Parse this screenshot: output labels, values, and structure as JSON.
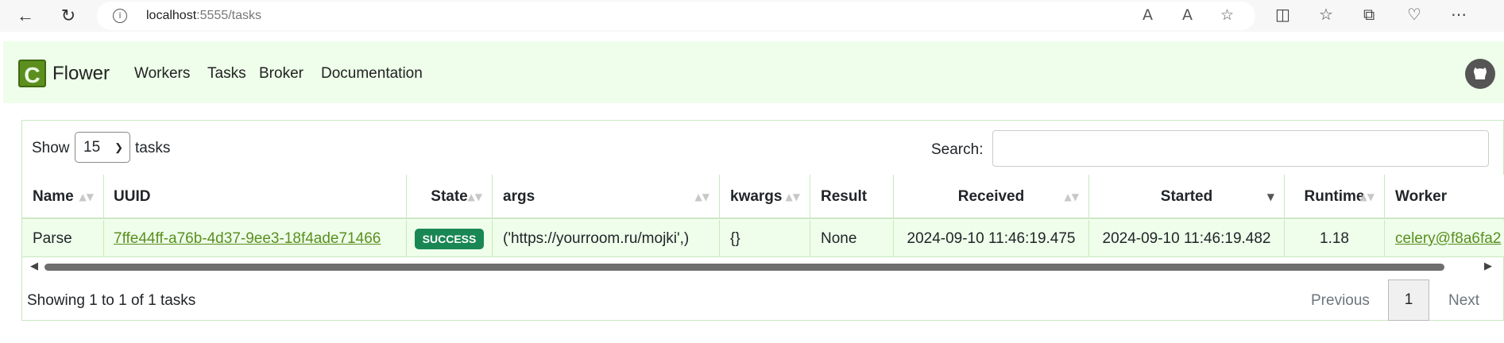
{
  "browser": {
    "url_host": "localhost",
    "url_rest": ":5555/tasks",
    "info_glyph": "i"
  },
  "app": {
    "brand_letter": "C",
    "brand_name": "Flower",
    "nav": [
      "Workers",
      "Tasks",
      "Broker",
      "Documentation"
    ]
  },
  "controls": {
    "show_label": "Show",
    "page_size": "15",
    "tasks_label": "tasks",
    "search_label": "Search:",
    "search_value": ""
  },
  "table": {
    "columns": [
      "Name",
      "UUID",
      "State",
      "args",
      "kwargs",
      "Result",
      "Received",
      "Started",
      "Runtime",
      "Worker"
    ],
    "rows": [
      {
        "name": "Parse",
        "uuid": "7ffe44ff-a76b-4d37-9ee3-18f4ade71466",
        "state": "SUCCESS",
        "args": "('https://yourroom.ru/mojki',)",
        "kwargs": "{}",
        "result": "None",
        "received": "2024-09-10 11:46:19.475",
        "started": "2024-09-10 11:46:19.482",
        "runtime": "1.18",
        "worker": "celery@f8a6fa2"
      }
    ]
  },
  "footer": {
    "showing": "Showing 1 to 1 of 1 tasks",
    "previous": "Previous",
    "current_page": "1",
    "next": "Next"
  },
  "colors": {
    "navbar_bg": "#eefeea",
    "success_badge": "#198754",
    "link": "#5a8f1f",
    "border": "#c9e8c0"
  }
}
